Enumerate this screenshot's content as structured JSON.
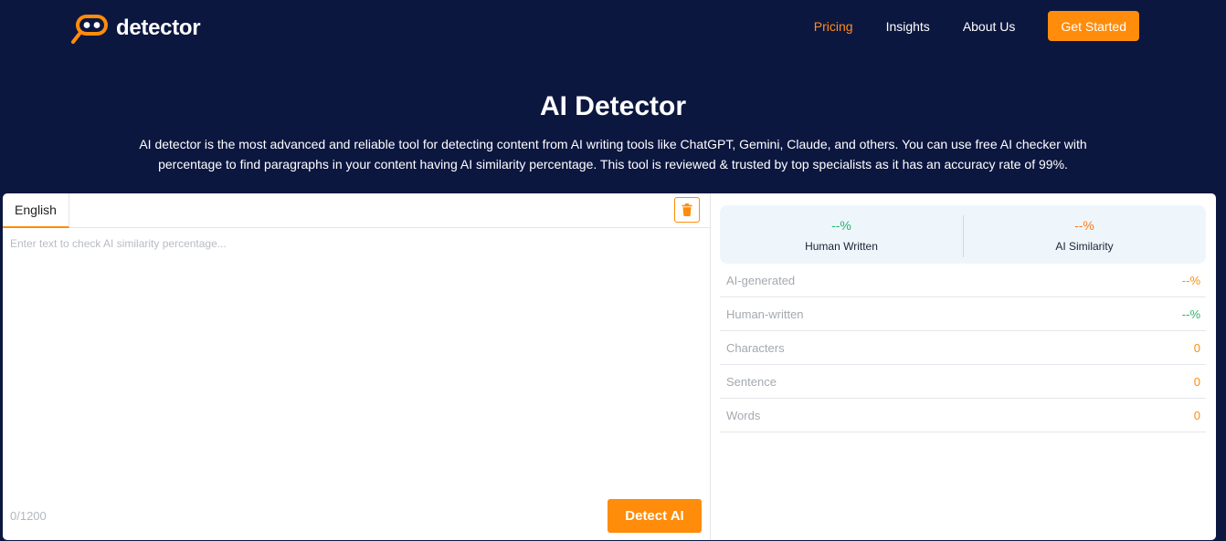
{
  "brand": {
    "name": "detector",
    "accent": "#ff8c0a",
    "background": "#0c1740"
  },
  "nav": {
    "items": [
      {
        "label": "Pricing",
        "active": true
      },
      {
        "label": "Insights",
        "active": false
      },
      {
        "label": "About Us",
        "active": false
      }
    ],
    "cta_label": "Get Started"
  },
  "hero": {
    "title": "AI Detector",
    "description": "AI detector is the most advanced and reliable tool for detecting content from AI writing tools like ChatGPT, Gemini, Claude, and others. You can use free AI checker with percentage to find paragraphs in your content having AI similarity percentage. This tool is reviewed & trusted by top specialists as it has an accuracy rate of 99%."
  },
  "editor": {
    "language_tab": "English",
    "placeholder": "Enter text to check AI similarity percentage...",
    "char_count": "0/1200",
    "detect_label": "Detect AI",
    "trash_icon": "trash-icon"
  },
  "results": {
    "summary": [
      {
        "value": "--%",
        "label": "Human Written",
        "color": "#28b36a"
      },
      {
        "value": "--%",
        "label": "AI Similarity",
        "color": "#ff7a1a"
      }
    ],
    "stats": [
      {
        "label": "AI-generated",
        "value": "--%"
      },
      {
        "label": "Human-written",
        "value": "--%"
      },
      {
        "label": "Characters",
        "value": "0"
      },
      {
        "label": "Sentence",
        "value": "0"
      },
      {
        "label": "Words",
        "value": "0"
      }
    ]
  }
}
